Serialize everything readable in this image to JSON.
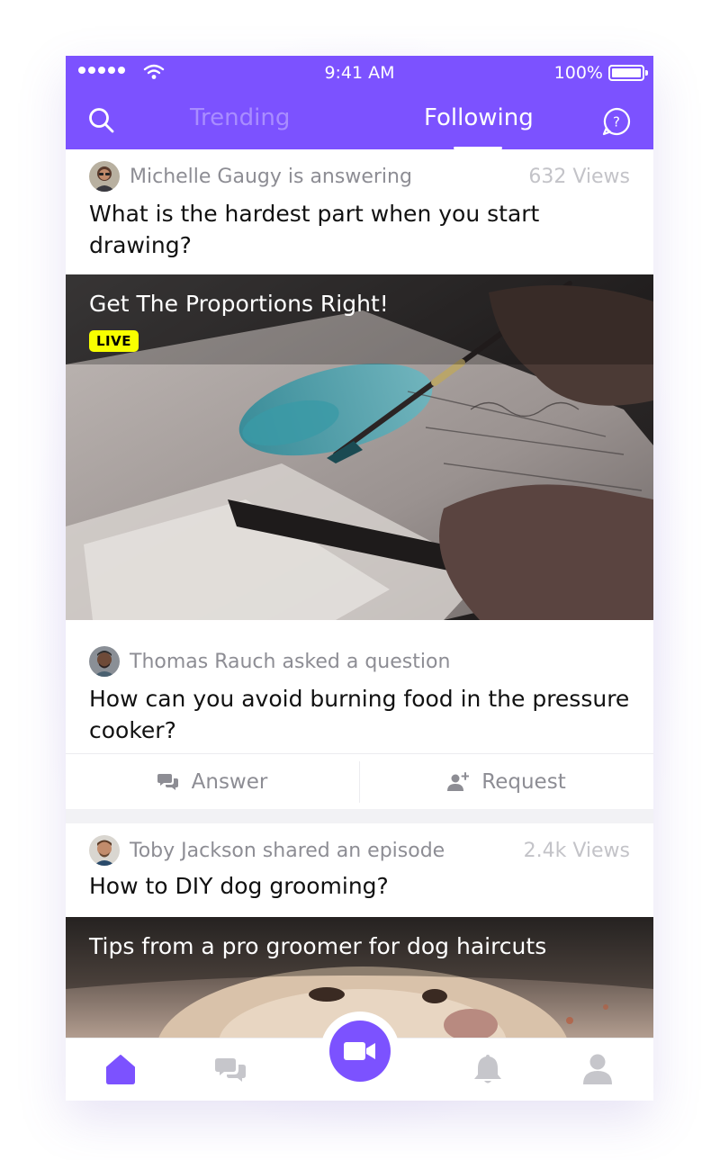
{
  "status_bar": {
    "time": "9:41 AM",
    "battery": "100%"
  },
  "header": {
    "tabs": [
      {
        "label": "Trending",
        "active": false
      },
      {
        "label": "Following",
        "active": true
      }
    ],
    "accent_color": "#7c52ff"
  },
  "feed": [
    {
      "author_line": "Michelle Gaugy is answering",
      "views": "632 Views",
      "question": "What is the hardest part when you start drawing?",
      "media_title": "Get The Proportions Right!",
      "badge": "LIVE"
    },
    {
      "author_line": "Thomas Rauch asked a question",
      "question": "How can you avoid burning food in the pressure cooker?",
      "actions": [
        {
          "label": "Answer",
          "icon": "chat-bubbles-icon"
        },
        {
          "label": "Request",
          "icon": "add-person-icon"
        }
      ]
    },
    {
      "author_line": "Toby Jackson shared an episode",
      "views": "2.4k Views",
      "question": "How to DIY dog grooming?",
      "media_title": "Tips from a pro groomer for dog haircuts"
    }
  ],
  "bottom_nav": [
    {
      "icon": "home-icon",
      "active": true
    },
    {
      "icon": "chat-bubbles-icon",
      "active": false
    },
    {
      "icon": "video-camera-icon",
      "active": false
    },
    {
      "icon": "bell-icon",
      "active": false
    },
    {
      "icon": "profile-icon",
      "active": false
    }
  ]
}
